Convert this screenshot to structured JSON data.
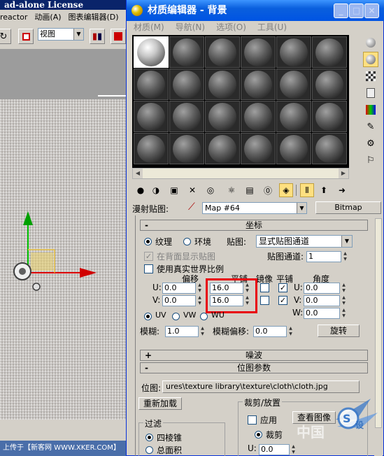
{
  "background_app": {
    "title": "ad-alone License",
    "menu": [
      "reactor",
      "动画(A)",
      "图表编辑器(D)"
    ],
    "viewport_select": "视图",
    "status_text": "上传于【新客网 WWW.XKER.COM】"
  },
  "window": {
    "title": "材质编辑器 - 背景",
    "caption_buttons": [
      "_",
      "□",
      "×"
    ],
    "menu": [
      "材质(M)",
      "导航(N)",
      "选项(O)",
      "工具(U)"
    ]
  },
  "map_row": {
    "label": "漫射贴图:",
    "map_name": "Map #64",
    "type_button": "Bitmap"
  },
  "coords": {
    "header": "坐标",
    "sign": "-",
    "mode_texture": "纹理",
    "mode_environ": "环境",
    "mapping_label": "贴图:",
    "mapping_value": "显式贴图通道",
    "show_back": "在背面显示贴图",
    "map_channel_label": "贴图通道:",
    "map_channel_value": "1",
    "real_world": "使用真实世界比例",
    "col_offset": "偏移",
    "col_tiling": "平铺",
    "col_mirror": "镜像",
    "col_tile": "平铺",
    "col_angle": "角度",
    "u_label": "U:",
    "v_label": "V:",
    "w_label": "W:",
    "u_offset": "0.0",
    "v_offset": "0.0",
    "u_tiling": "16.0",
    "v_tiling": "16.0",
    "u_angle": "0.0",
    "v_angle": "0.0",
    "w_angle": "0.0",
    "uv": "UV",
    "vw": "VW",
    "wu": "WU",
    "blur_label": "模糊:",
    "blur_value": "1.0",
    "blur_offset_label": "模糊偏移:",
    "blur_offset_value": "0.0",
    "rotate_button": "旋转"
  },
  "noise": {
    "header": "噪波",
    "sign": "+"
  },
  "bitmap_params": {
    "header": "位图参数",
    "sign": "-",
    "bitmap_label": "位图:",
    "bitmap_path": "ures\\texture library\\texture\\cloth\\cloth.jpg",
    "reload_button": "重新加载",
    "crop_group": "裁剪/放置",
    "apply_label": "应用",
    "view_image_button": "查看图像",
    "crop_label": "裁剪",
    "u_label": "U:",
    "u_value": "0.0",
    "filter_group": "过滤",
    "pyramidal": "四棱锥",
    "summed_area": "总面积"
  },
  "watermark": {
    "text": "中国"
  },
  "colors": {
    "title_bar": "#0054e3",
    "highlight": "#e8000c",
    "panel": "#d4d0c8"
  }
}
